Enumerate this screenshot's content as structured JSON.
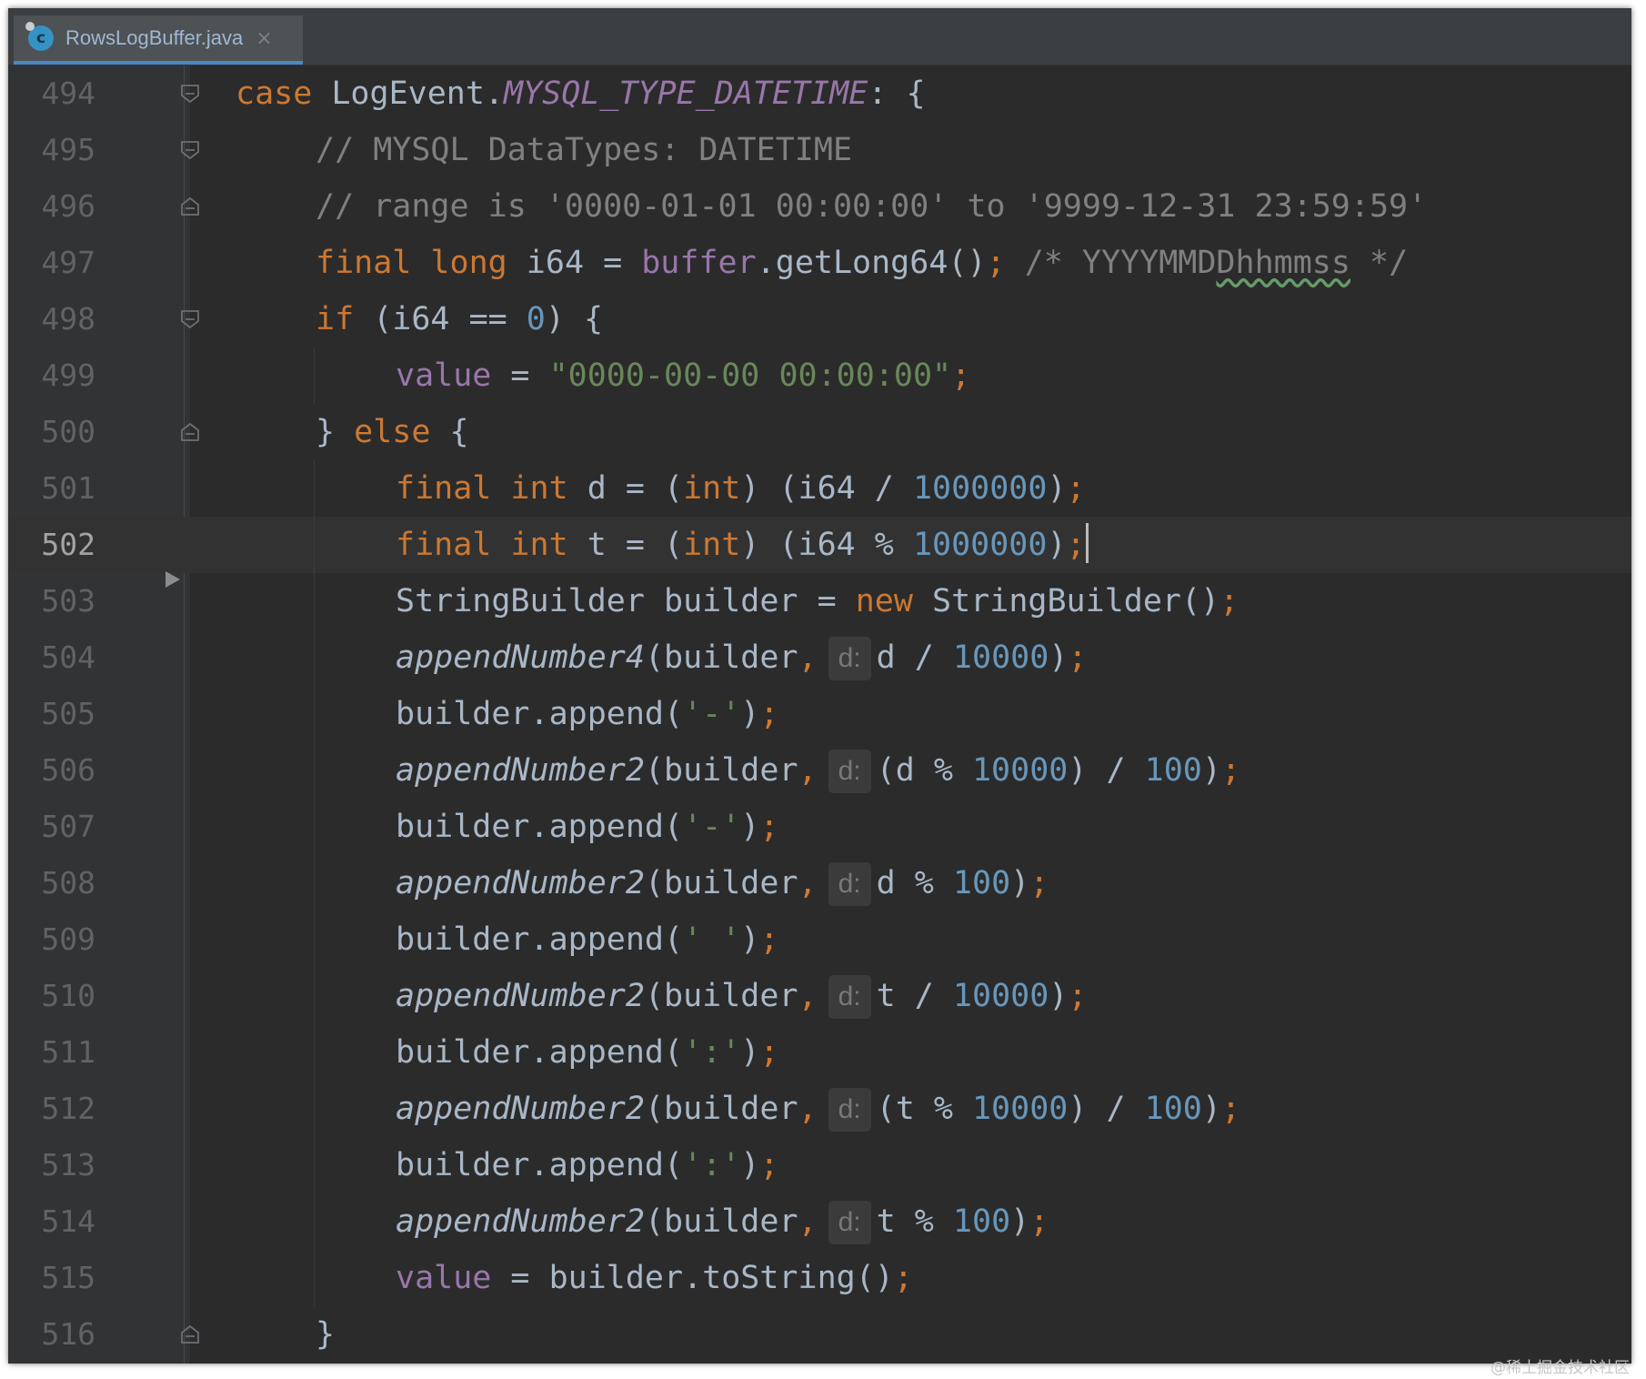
{
  "tab": {
    "file_name": "RowsLogBuffer.java",
    "close_glyph": "×",
    "icon_letter": "c"
  },
  "watermark": "@稀土掘金技术社区",
  "lines": [
    {
      "n": "494",
      "fold": "open",
      "indent": 0,
      "tokens": [
        {
          "t": "case ",
          "c": "kw"
        },
        {
          "t": "LogEvent.",
          "c": "plain"
        },
        {
          "t": "MYSQL_TYPE_DATETIME",
          "c": "const"
        },
        {
          "t": ": {",
          "c": "plain"
        }
      ]
    },
    {
      "n": "495",
      "fold": "open",
      "indent": 1,
      "tokens": [
        {
          "t": "// MYSQL DataTypes: DATETIME",
          "c": "comment"
        }
      ]
    },
    {
      "n": "496",
      "fold": "close",
      "indent": 1,
      "tokens": [
        {
          "t": "// range is '0000-01-01 00:00:00' to '9999-12-31 23:59:59'",
          "c": "comment"
        }
      ]
    },
    {
      "n": "497",
      "fold": "",
      "indent": 1,
      "tokens": [
        {
          "t": "final long ",
          "c": "kw"
        },
        {
          "t": "i64 = ",
          "c": "plain"
        },
        {
          "t": "buffer",
          "c": "field"
        },
        {
          "t": ".getLong64()",
          "c": "plain"
        },
        {
          "t": "; ",
          "c": "kw"
        },
        {
          "t": "/* YYYYMMD",
          "c": "comment"
        },
        {
          "t": "Dhhmmss",
          "c": "comment-typo"
        },
        {
          "t": " */",
          "c": "comment"
        }
      ]
    },
    {
      "n": "498",
      "fold": "open",
      "indent": 1,
      "tokens": [
        {
          "t": "if ",
          "c": "kw"
        },
        {
          "t": "(i64 == ",
          "c": "plain"
        },
        {
          "t": "0",
          "c": "num"
        },
        {
          "t": ") {",
          "c": "plain"
        }
      ]
    },
    {
      "n": "499",
      "fold": "",
      "indent": 2,
      "tokens": [
        {
          "t": "value",
          "c": "field"
        },
        {
          "t": " = ",
          "c": "plain"
        },
        {
          "t": "\"0000-00-00 00:00:00\"",
          "c": "str"
        },
        {
          "t": ";",
          "c": "kw"
        }
      ]
    },
    {
      "n": "500",
      "fold": "close",
      "indent": 1,
      "tokens": [
        {
          "t": "} ",
          "c": "plain"
        },
        {
          "t": "else ",
          "c": "kw"
        },
        {
          "t": "{",
          "c": "plain"
        }
      ]
    },
    {
      "n": "501",
      "fold": "",
      "indent": 2,
      "tokens": [
        {
          "t": "final int ",
          "c": "kw"
        },
        {
          "t": "d = (",
          "c": "plain"
        },
        {
          "t": "int",
          "c": "kw"
        },
        {
          "t": ") (i64 / ",
          "c": "plain"
        },
        {
          "t": "1000000",
          "c": "num"
        },
        {
          "t": ")",
          "c": "plain"
        },
        {
          "t": ";",
          "c": "kw"
        }
      ]
    },
    {
      "n": "502",
      "fold": "",
      "indent": 2,
      "current": true,
      "tokens": [
        {
          "t": "final int ",
          "c": "kw"
        },
        {
          "t": "t = (",
          "c": "plain"
        },
        {
          "t": "int",
          "c": "kw"
        },
        {
          "t": ") (i64 % ",
          "c": "plain"
        },
        {
          "t": "1000000",
          "c": "num"
        },
        {
          "t": ")",
          "c": "plain"
        },
        {
          "t": ";",
          "c": "kw"
        },
        {
          "t": "",
          "c": "caret"
        }
      ]
    },
    {
      "n": "503",
      "fold": "",
      "indent": 2,
      "tokens": [
        {
          "t": "StringBuilder builder = ",
          "c": "plain"
        },
        {
          "t": "new ",
          "c": "kw"
        },
        {
          "t": "StringBuilder()",
          "c": "plain"
        },
        {
          "t": ";",
          "c": "kw"
        }
      ]
    },
    {
      "n": "504",
      "fold": "",
      "indent": 2,
      "tokens": [
        {
          "t": "appendNumber4",
          "c": "italic"
        },
        {
          "t": "(builder",
          "c": "plain"
        },
        {
          "t": ",",
          "c": "kw"
        },
        {
          "t": "d:",
          "c": "hint"
        },
        {
          "t": "d / ",
          "c": "plain"
        },
        {
          "t": "10000",
          "c": "num"
        },
        {
          "t": ")",
          "c": "plain"
        },
        {
          "t": ";",
          "c": "kw"
        }
      ]
    },
    {
      "n": "505",
      "fold": "",
      "indent": 2,
      "tokens": [
        {
          "t": "builder.append(",
          "c": "plain"
        },
        {
          "t": "'-'",
          "c": "str"
        },
        {
          "t": ")",
          "c": "plain"
        },
        {
          "t": ";",
          "c": "kw"
        }
      ]
    },
    {
      "n": "506",
      "fold": "",
      "indent": 2,
      "tokens": [
        {
          "t": "appendNumber2",
          "c": "italic"
        },
        {
          "t": "(builder",
          "c": "plain"
        },
        {
          "t": ",",
          "c": "kw"
        },
        {
          "t": "d:",
          "c": "hint"
        },
        {
          "t": "(d % ",
          "c": "plain"
        },
        {
          "t": "10000",
          "c": "num"
        },
        {
          "t": ") / ",
          "c": "plain"
        },
        {
          "t": "100",
          "c": "num"
        },
        {
          "t": ")",
          "c": "plain"
        },
        {
          "t": ";",
          "c": "kw"
        }
      ]
    },
    {
      "n": "507",
      "fold": "",
      "indent": 2,
      "tokens": [
        {
          "t": "builder.append(",
          "c": "plain"
        },
        {
          "t": "'-'",
          "c": "str"
        },
        {
          "t": ")",
          "c": "plain"
        },
        {
          "t": ";",
          "c": "kw"
        }
      ]
    },
    {
      "n": "508",
      "fold": "",
      "indent": 2,
      "tokens": [
        {
          "t": "appendNumber2",
          "c": "italic"
        },
        {
          "t": "(builder",
          "c": "plain"
        },
        {
          "t": ",",
          "c": "kw"
        },
        {
          "t": "d:",
          "c": "hint"
        },
        {
          "t": "d % ",
          "c": "plain"
        },
        {
          "t": "100",
          "c": "num"
        },
        {
          "t": ")",
          "c": "plain"
        },
        {
          "t": ";",
          "c": "kw"
        }
      ]
    },
    {
      "n": "509",
      "fold": "",
      "indent": 2,
      "tokens": [
        {
          "t": "builder.append(",
          "c": "plain"
        },
        {
          "t": "' '",
          "c": "str"
        },
        {
          "t": ")",
          "c": "plain"
        },
        {
          "t": ";",
          "c": "kw"
        }
      ]
    },
    {
      "n": "510",
      "fold": "",
      "indent": 2,
      "tokens": [
        {
          "t": "appendNumber2",
          "c": "italic"
        },
        {
          "t": "(builder",
          "c": "plain"
        },
        {
          "t": ",",
          "c": "kw"
        },
        {
          "t": "d:",
          "c": "hint"
        },
        {
          "t": "t / ",
          "c": "plain"
        },
        {
          "t": "10000",
          "c": "num"
        },
        {
          "t": ")",
          "c": "plain"
        },
        {
          "t": ";",
          "c": "kw"
        }
      ]
    },
    {
      "n": "511",
      "fold": "",
      "indent": 2,
      "tokens": [
        {
          "t": "builder.append(",
          "c": "plain"
        },
        {
          "t": "':'",
          "c": "str"
        },
        {
          "t": ")",
          "c": "plain"
        },
        {
          "t": ";",
          "c": "kw"
        }
      ]
    },
    {
      "n": "512",
      "fold": "",
      "indent": 2,
      "tokens": [
        {
          "t": "appendNumber2",
          "c": "italic"
        },
        {
          "t": "(builder",
          "c": "plain"
        },
        {
          "t": ",",
          "c": "kw"
        },
        {
          "t": "d:",
          "c": "hint"
        },
        {
          "t": "(t % ",
          "c": "plain"
        },
        {
          "t": "10000",
          "c": "num"
        },
        {
          "t": ") / ",
          "c": "plain"
        },
        {
          "t": "100",
          "c": "num"
        },
        {
          "t": ")",
          "c": "plain"
        },
        {
          "t": ";",
          "c": "kw"
        }
      ]
    },
    {
      "n": "513",
      "fold": "",
      "indent": 2,
      "tokens": [
        {
          "t": "builder.append(",
          "c": "plain"
        },
        {
          "t": "':'",
          "c": "str"
        },
        {
          "t": ")",
          "c": "plain"
        },
        {
          "t": ";",
          "c": "kw"
        }
      ]
    },
    {
      "n": "514",
      "fold": "",
      "indent": 2,
      "tokens": [
        {
          "t": "appendNumber2",
          "c": "italic"
        },
        {
          "t": "(builder",
          "c": "plain"
        },
        {
          "t": ",",
          "c": "kw"
        },
        {
          "t": "d:",
          "c": "hint"
        },
        {
          "t": "t % ",
          "c": "plain"
        },
        {
          "t": "100",
          "c": "num"
        },
        {
          "t": ")",
          "c": "plain"
        },
        {
          "t": ";",
          "c": "kw"
        }
      ]
    },
    {
      "n": "515",
      "fold": "",
      "indent": 2,
      "tokens": [
        {
          "t": "value",
          "c": "field"
        },
        {
          "t": " = builder.toString()",
          "c": "plain"
        },
        {
          "t": ";",
          "c": "kw"
        }
      ]
    },
    {
      "n": "516",
      "fold": "close",
      "indent": 1,
      "tokens": [
        {
          "t": "}",
          "c": "plain"
        }
      ]
    }
  ],
  "colors": {
    "kw": "#cc7832",
    "plain": "#a9b7c6",
    "const": "#9876aa",
    "field": "#9876aa",
    "comment": "#808080",
    "num": "#6897bb",
    "str": "#6a8759",
    "italic": "#a9b7c6",
    "typo_underline": "#659c6b"
  }
}
